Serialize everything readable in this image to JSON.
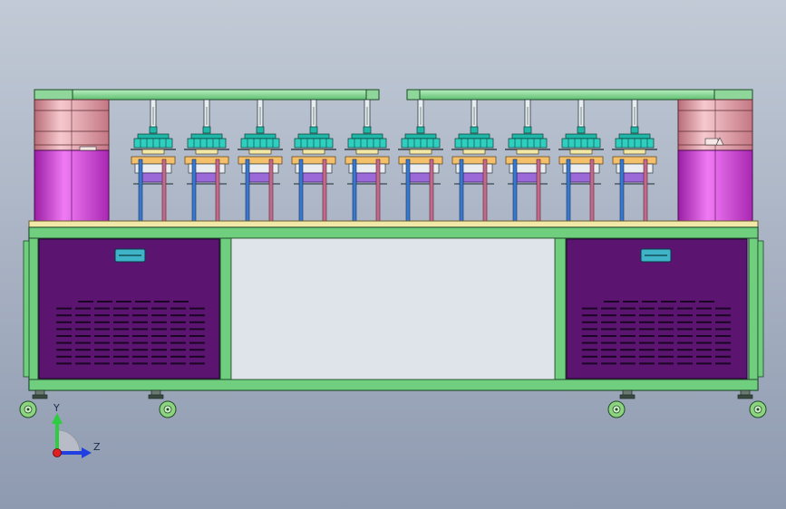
{
  "viewport": {
    "background_top": "#c2cad6",
    "background_bottom": "#8e9ab0"
  },
  "colors": {
    "frame_green": "#6fcf7f",
    "frame_dark": "#1e4a28",
    "table_top": "#f2e9a8",
    "panel_purple": "#5b1470",
    "cylinder_pink": "#e7a3aa",
    "cylinder_magenta": "#d23ad8",
    "station_blue": "#3a78d0",
    "station_pink": "#c26a8a",
    "station_teal": "#1fb8a8",
    "station_violet": "#9c6ad8",
    "handle_cyan": "#3fb4c8",
    "wheel_green": "#8cd47e"
  },
  "machine": {
    "station_count": 10,
    "vent_rows_per_door": 10,
    "wheel_count": 4
  },
  "axis_triad": {
    "y_label": "Y",
    "z_label": "Z",
    "y_color": "#2ecc40",
    "z_color": "#2040e0",
    "origin_color": "#e02020"
  }
}
